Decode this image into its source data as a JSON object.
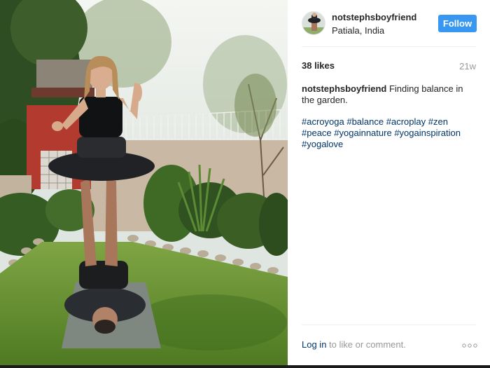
{
  "post": {
    "username": "notstephsboyfriend",
    "location": "Patiala, India",
    "follow_label": "Follow",
    "likes": "38 likes",
    "timestamp": "21w",
    "caption_user": "notstephsboyfriend",
    "caption_text": "Finding balance in the garden.",
    "hashtags": [
      "#acroyoga",
      "#balance",
      "#acroplay",
      "#zen",
      "#peace",
      "#yogainnature",
      "#yogainspiration",
      "#yogalove"
    ],
    "login_link": "Log in",
    "login_rest": "to like or comment.",
    "more_icon": "ellipsis-icon"
  },
  "colors": {
    "accent": "#3897f0",
    "link": "#003569",
    "muted": "#999999",
    "text": "#262626"
  }
}
